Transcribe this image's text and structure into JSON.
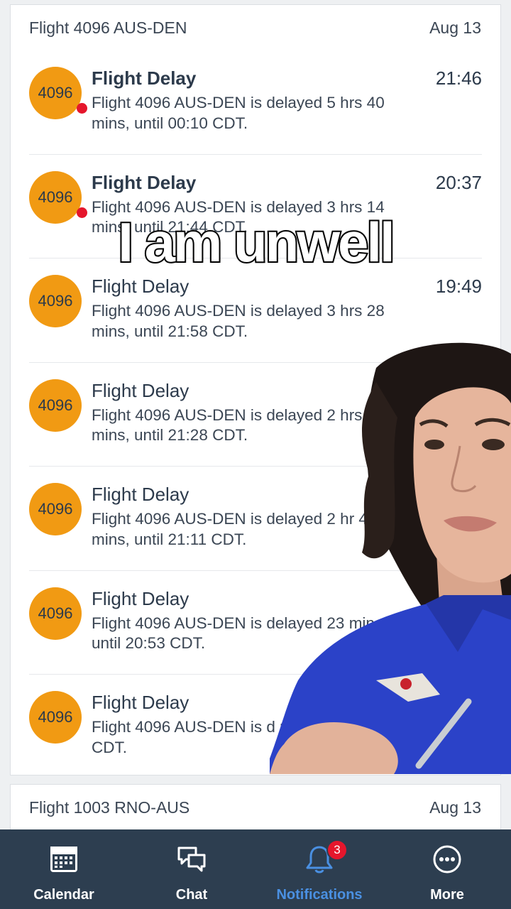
{
  "flight_groups": [
    {
      "title": "Flight 4096 AUS-DEN",
      "date": "Aug 13",
      "notifications": [
        {
          "badge": "4096",
          "title": "Flight Delay",
          "time": "21:46",
          "body": "Flight 4096 AUS-DEN is delayed 5 hrs 40 mins, until 00:10 CDT.",
          "unread": true
        },
        {
          "badge": "4096",
          "title": "Flight Delay",
          "time": "20:37",
          "body": "Flight 4096 AUS-DEN is delayed 3 hrs 14 mins, until 21:44 CDT.",
          "unread": true
        },
        {
          "badge": "4096",
          "title": "Flight Delay",
          "time": "19:49",
          "body": "Flight 4096 AUS-DEN is delayed 3 hrs 28 mins, until 21:58 CDT.",
          "unread": false
        },
        {
          "badge": "4096",
          "title": "Flight Delay",
          "time": "",
          "body": "Flight 4096 AUS-DEN is delayed 2 hrs mins, until 21:28 CDT.",
          "unread": false
        },
        {
          "badge": "4096",
          "title": "Flight Delay",
          "time": "",
          "body": "Flight 4096 AUS-DEN is delayed 2 hr 41 mins, until 21:11 CDT.",
          "unread": false
        },
        {
          "badge": "4096",
          "title": "Flight Delay",
          "time": "",
          "body": "Flight 4096 AUS-DEN is delayed 23 mins, until 20:53 CDT.",
          "unread": false
        },
        {
          "badge": "4096",
          "title": "Flight Delay",
          "time": "",
          "body": "Flight 4096 AUS-DEN is d mins, until 20:38 CDT.",
          "unread": false
        }
      ]
    },
    {
      "title": "Flight 1003 RNO-AUS",
      "date": "Aug 13"
    }
  ],
  "overlay_caption": "I am unwell",
  "tabbar": {
    "tabs": [
      {
        "label": "Calendar",
        "icon": "calendar-icon",
        "active": false
      },
      {
        "label": "Chat",
        "icon": "chat-icon",
        "active": false
      },
      {
        "label": "Notifications",
        "icon": "bell-icon",
        "active": true,
        "badge": "3"
      },
      {
        "label": "More",
        "icon": "more-icon",
        "active": false
      }
    ]
  },
  "colors": {
    "badge_orange": "#f19a13",
    "unread_red": "#e5162c",
    "tabbar_bg": "#2d3e50",
    "active_tab": "#4a90e2",
    "uniform_blue": "#2b42c8"
  }
}
